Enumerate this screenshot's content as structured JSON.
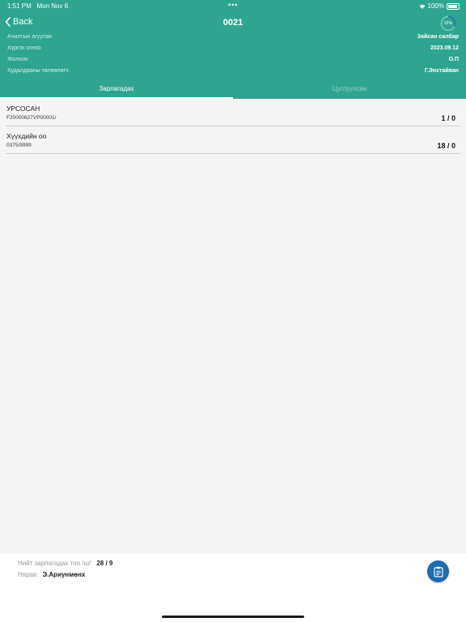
{
  "status_bar": {
    "time": "1:51 PM",
    "date": "Mon Nov 6",
    "battery": "100%"
  },
  "nav": {
    "back_label": "Back",
    "title": "0021",
    "progress_label": "32%",
    "progress_value": 0.32
  },
  "info": [
    {
      "label": "Ачилтын агуулах",
      "value": "Зайсан салбар"
    },
    {
      "label": "Хүргэх огноо",
      "value": "2023.09.12"
    },
    {
      "label": "Жолооч",
      "value": "О.П"
    },
    {
      "label": "Худалдааны төлөөлөгч",
      "value": "Г.Энхтайван"
    }
  ],
  "tabs": [
    {
      "label": "Зарлагадах"
    },
    {
      "label": "Цуглуулсан"
    }
  ],
  "items": [
    {
      "name": "УРСОСАН",
      "code": "F20000627VP00001/",
      "qty": "1 / 0"
    },
    {
      "name": "Хүүхдийн оо",
      "code": "0375/9999",
      "qty": "18 / 0"
    }
  ],
  "footer": {
    "total_label": "Нийт зарлагадах тоо /ш/:",
    "total_value": "28 / 9",
    "clerk_label": "Нярав:",
    "clerk_value": "Э.Ариунмөнх"
  },
  "colors": {
    "header": "#2ea68f",
    "fab": "#1d6bb1"
  },
  "icons": {
    "back": "chevron-left-icon",
    "fab": "clipboard-icon"
  }
}
